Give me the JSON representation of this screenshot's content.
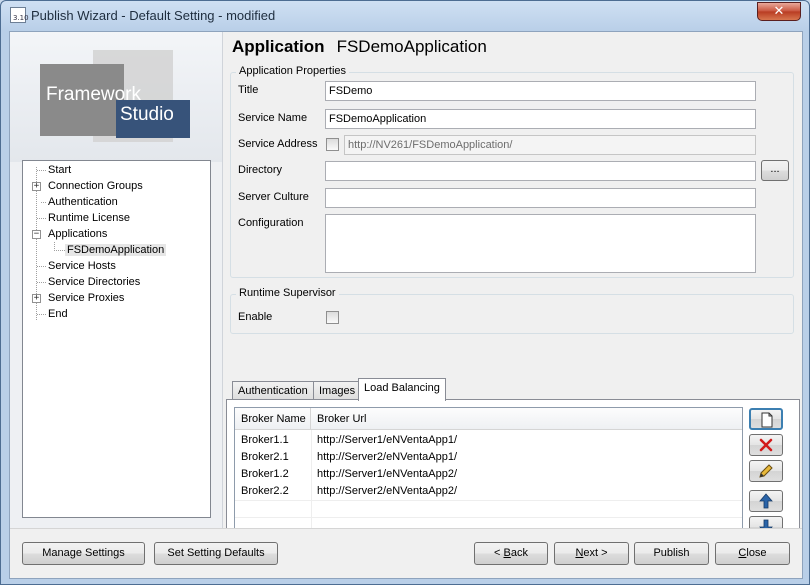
{
  "window": {
    "title": "Publish Wizard - Default Setting - modified",
    "app_icon_version": "3.10",
    "close_glyph": "✕"
  },
  "logo": {
    "word1": "Framework",
    "word2": "Studio"
  },
  "tree": {
    "items": [
      {
        "label": "Start"
      },
      {
        "label": "Connection Groups",
        "expander": "+"
      },
      {
        "label": "Authentication"
      },
      {
        "label": "Runtime License"
      },
      {
        "label": "Applications",
        "expander": "−"
      },
      {
        "label": "FSDemoApplication"
      },
      {
        "label": "Service Hosts"
      },
      {
        "label": "Service Directories"
      },
      {
        "label": "Service Proxies",
        "expander": "+"
      },
      {
        "label": "End"
      }
    ]
  },
  "heading": {
    "type": "Application",
    "name": "FSDemoApplication"
  },
  "app_properties": {
    "group_title": "Application Properties",
    "title_label": "Title",
    "title_value": "FSDemo",
    "service_name_label": "Service Name",
    "service_name_value": "FSDemoApplication",
    "service_address_label": "Service Address",
    "service_address_value": "http://NV261/FSDemoApplication/",
    "directory_label": "Directory",
    "directory_value": "",
    "browse_label": "...",
    "server_culture_label": "Server Culture",
    "server_culture_value": "",
    "configuration_label": "Configuration",
    "configuration_value": ""
  },
  "runtime_supervisor": {
    "group_title": "Runtime Supervisor",
    "enable_label": "Enable"
  },
  "tabs": [
    {
      "label": "Authentication"
    },
    {
      "label": "Images"
    },
    {
      "label": "Load Balancing"
    }
  ],
  "brokers": {
    "columns": [
      "Broker Name",
      "Broker Url"
    ],
    "rows": [
      {
        "name": "Broker1.1",
        "url": "http://Server1/eNVentaApp1/"
      },
      {
        "name": "Broker2.1",
        "url": "http://Server2/eNVentaApp1/"
      },
      {
        "name": "Broker1.2",
        "url": "http://Server1/eNVentaApp2/"
      },
      {
        "name": "Broker2.2",
        "url": "http://Server2/eNVentaApp2/"
      }
    ]
  },
  "side_buttons": [
    "new-document-icon",
    "delete-icon",
    "edit-pencil-icon",
    "move-up-icon",
    "move-down-icon"
  ],
  "footer": {
    "manage_settings": "Manage Settings",
    "set_defaults": "Set Setting Defaults",
    "back_pre": "< ",
    "back_mn": "B",
    "back_post": "ack",
    "next_mn": "N",
    "next_post": "ext >",
    "publish": "Publish",
    "close_mn": "C",
    "close_post": "lose"
  },
  "colors": {
    "logo_blue": "#37537a",
    "delete_red": "#d21a1a",
    "arrow_blue": "#2a64a8"
  }
}
